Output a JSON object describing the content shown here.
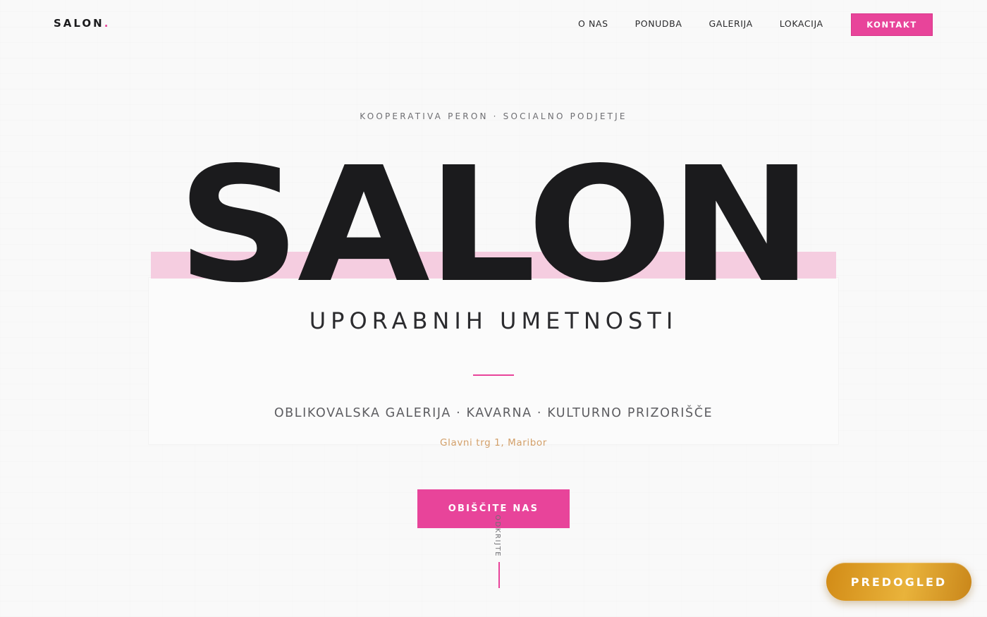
{
  "brand": {
    "logo_text": "SALON",
    "logo_dot": "."
  },
  "nav": {
    "items": [
      {
        "label": "O NAS"
      },
      {
        "label": "PONUDBA"
      },
      {
        "label": "GALERIJA"
      },
      {
        "label": "LOKACIJA"
      }
    ],
    "cta_label": "KONTAKT"
  },
  "hero": {
    "eyebrow": "KOOPERATIVA PERON · SOCIALNO PODJETJE",
    "title": "SALON",
    "subtitle": "UPORABNIH UMETNOSTI",
    "tagline": "OBLIKOVALSKA GALERIJA · KAVARNA · KULTURNO PRIZORIŠČE",
    "address": "Glavni trg 1, Maribor",
    "cta_label": "OBIŠČITE NAS",
    "scroll_text": "ODKRIJTE"
  },
  "floating": {
    "preview_label": "PREDOGLED"
  },
  "colors": {
    "accent_pink": "#e8449a",
    "highlight_pink": "#f5cde0",
    "address_gold": "#d3a06a",
    "preview_gold": "#e0a52a",
    "text_dark": "#1b1b1d",
    "background": "#f9f9f9"
  }
}
